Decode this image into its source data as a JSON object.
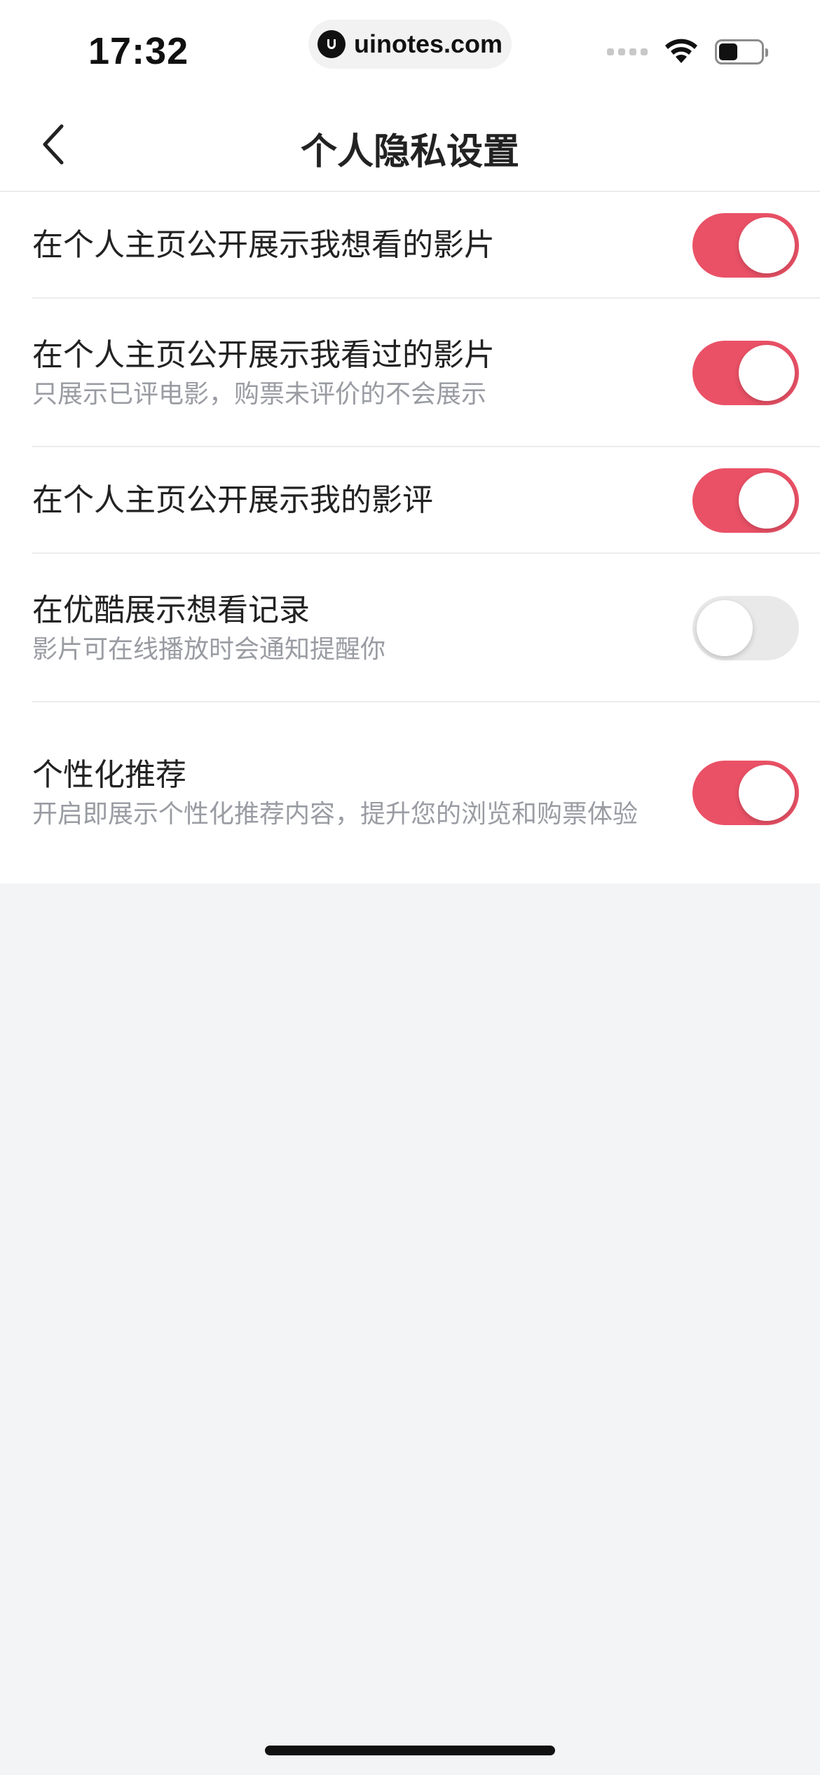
{
  "status_bar": {
    "time": "17:32",
    "url": "uinotes.com"
  },
  "nav": {
    "title": "个人隐私设置"
  },
  "settings": [
    {
      "title": "在个人主页公开展示我想看的影片",
      "description": "",
      "enabled": true
    },
    {
      "title": "在个人主页公开展示我看过的影片",
      "description": "只展示已评电影，购票未评价的不会展示",
      "enabled": true
    },
    {
      "title": "在个人主页公开展示我的影评",
      "description": "",
      "enabled": true
    },
    {
      "title": "在优酷展示想看记录",
      "description": "影片可在线播放时会通知提醒你",
      "enabled": false
    },
    {
      "title": "个性化推荐",
      "description": "开启即展示个性化推荐内容，提升您的浏览和购票体验",
      "enabled": true
    }
  ],
  "colors": {
    "toggle_on": "#ea5166",
    "toggle_off": "#e9e9ea",
    "page_background": "#f3f4f6"
  }
}
